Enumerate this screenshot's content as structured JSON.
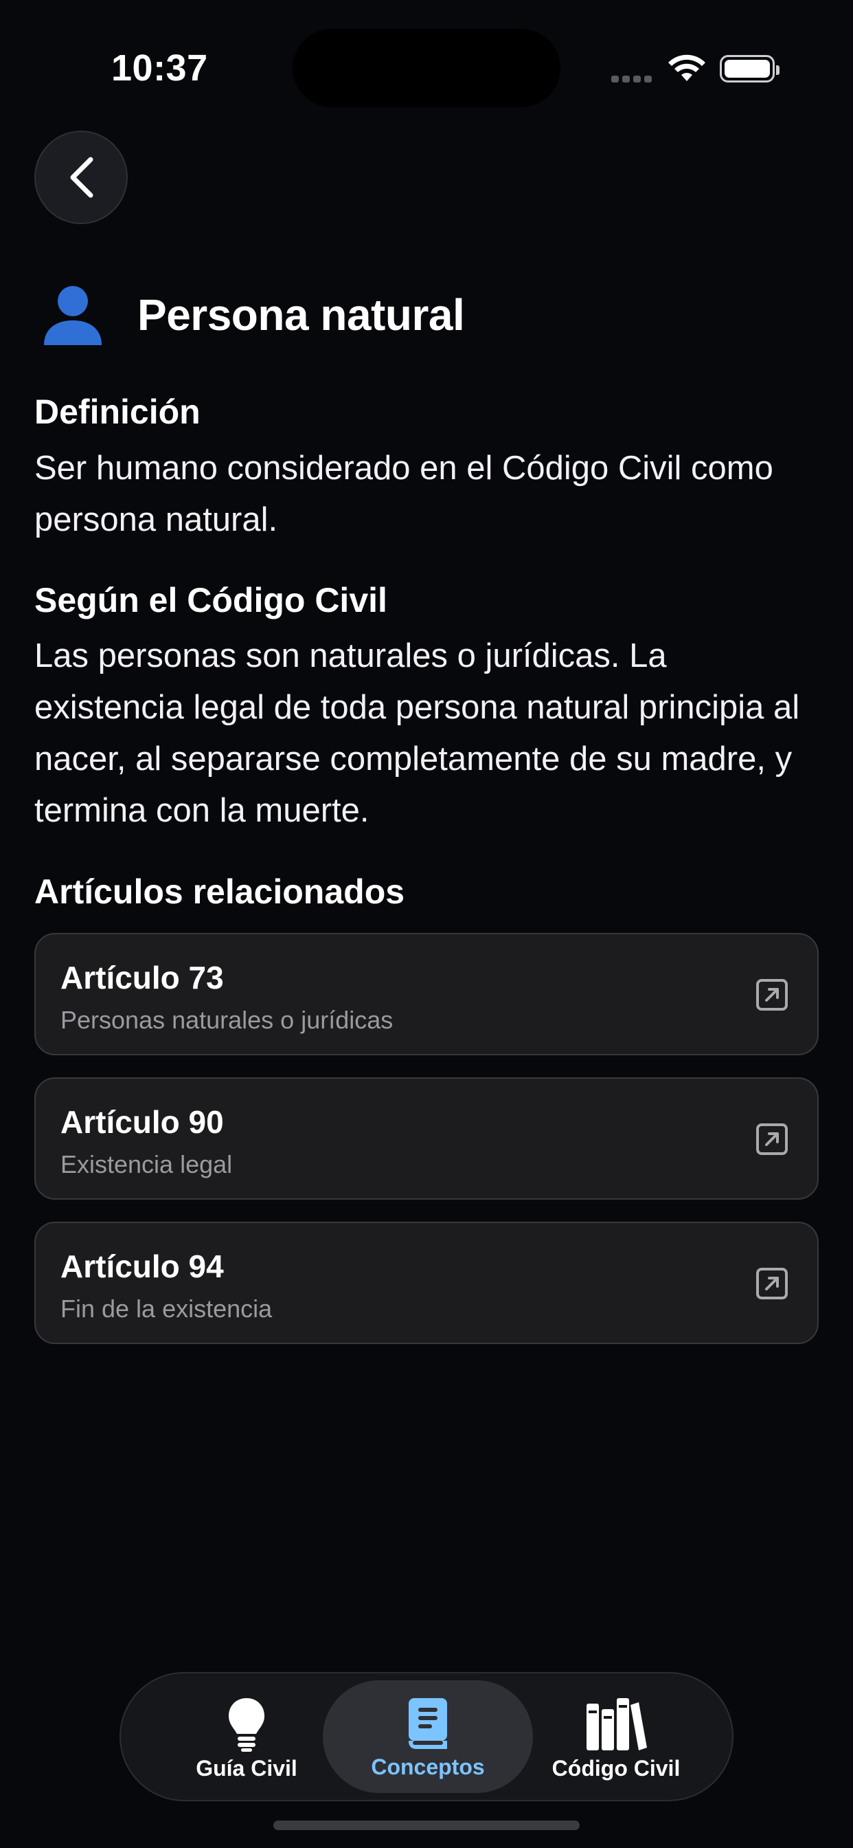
{
  "status_bar": {
    "time": "10:37"
  },
  "header": {
    "title": "Persona natural",
    "icon": "person-icon"
  },
  "definition": {
    "heading": "Definición",
    "text": "Ser humano considerado en el Código Civil como persona natural."
  },
  "codigo": {
    "heading": "Según el Código Civil",
    "text": "Las personas son naturales o jurídicas. La existencia legal de toda persona natural principia al nacer, al separarse completamente de su madre, y termina con la muerte."
  },
  "related": {
    "heading": "Artículos relacionados",
    "items": [
      {
        "title": "Artículo 73",
        "subtitle": "Personas naturales o jurídicas"
      },
      {
        "title": "Artículo 90",
        "subtitle": "Existencia legal"
      },
      {
        "title": "Artículo 94",
        "subtitle": "Fin de la existencia"
      }
    ]
  },
  "tabbar": {
    "tabs": [
      {
        "label": "Guía Civil",
        "icon": "lightbulb-icon",
        "active": false
      },
      {
        "label": "Conceptos",
        "icon": "book-icon",
        "active": true
      },
      {
        "label": "Código Civil",
        "icon": "books-icon",
        "active": false
      }
    ],
    "active_color": "#7cc4ff"
  },
  "colors": {
    "background": "#07080c",
    "accent_icon": "#2f6fd6",
    "card": "#1c1c1f"
  }
}
